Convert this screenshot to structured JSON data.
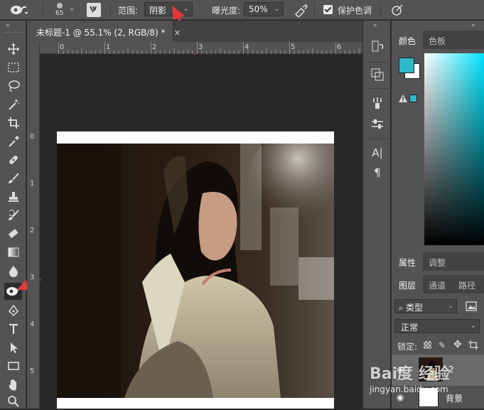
{
  "options": {
    "brush_size": "65",
    "range_label": "范围:",
    "range_value": "阴影",
    "exposure_label": "曝光度:",
    "exposure_value": "50%",
    "protect_label": "保护色调",
    "protect_checked": true
  },
  "document": {
    "tab_title": "未标题-1 @ 55.1% (2, RGB/8) *",
    "close_glyph": "×"
  },
  "rulers": {
    "top": [
      "0",
      "1",
      "2",
      "3",
      "4",
      "5",
      "6"
    ],
    "left": [
      "0",
      "1",
      "2",
      "3",
      "4",
      "5"
    ]
  },
  "panels": {
    "color_tabs": [
      "颜色",
      "色板"
    ],
    "properties_tabs": [
      "属性",
      "调整"
    ],
    "layers_tabs": [
      "图层",
      "通道",
      "路径"
    ],
    "filter_kind": "类型",
    "blend_mode": "正常",
    "lock_label": "锁定:",
    "layer_name_top": "2",
    "layer_name_bottom": "背景"
  },
  "dock": {
    "text_icon": "A|",
    "paragraph_icon": "¶"
  },
  "watermark": {
    "brand": "Bai度 经验",
    "url": "jingyan.baidu.com"
  },
  "colors": {
    "foreground": "#2fb8c8",
    "background": "#ffffff",
    "annotation_arrow": "#e53935",
    "panel_bg": "#535353"
  }
}
